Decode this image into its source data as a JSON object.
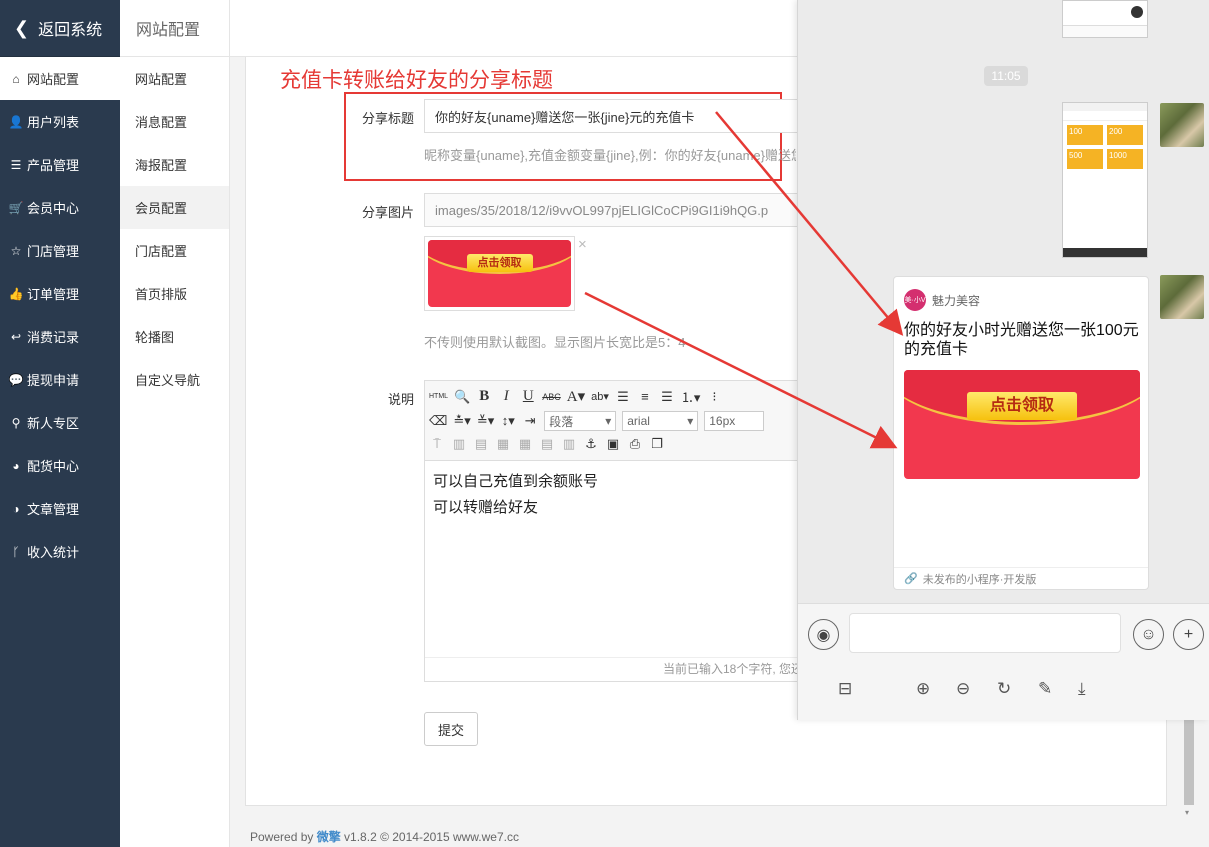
{
  "sidebar": {
    "back_label": "返回系统",
    "items": [
      {
        "label": "网站配置",
        "icon": "home-icon",
        "glyph": "⌂",
        "active": true
      },
      {
        "label": "用户列表",
        "icon": "user-icon",
        "glyph": "👤",
        "active": false
      },
      {
        "label": "产品管理",
        "icon": "server-icon",
        "glyph": "☰",
        "active": false
      },
      {
        "label": "会员中心",
        "icon": "cart-icon",
        "glyph": "🛒",
        "active": false
      },
      {
        "label": "门店管理",
        "icon": "star-icon",
        "glyph": "☆",
        "active": false
      },
      {
        "label": "订单管理",
        "icon": "thumbs-up-icon",
        "glyph": "👍",
        "active": false
      },
      {
        "label": "消费记录",
        "icon": "reply-icon",
        "glyph": "↩",
        "active": false
      },
      {
        "label": "提现申请",
        "icon": "wechat-icon",
        "glyph": "💬",
        "active": false
      },
      {
        "label": "新人专区",
        "icon": "map-pin-icon",
        "glyph": "⚲",
        "active": false
      },
      {
        "label": "配货中心",
        "icon": "pie-chart-icon",
        "glyph": "◕",
        "active": false
      },
      {
        "label": "文章管理",
        "icon": "adjust-icon",
        "glyph": "◑",
        "active": false
      },
      {
        "label": "收入统计",
        "icon": "branch-icon",
        "glyph": "ᚴ",
        "active": false
      }
    ]
  },
  "subnav": {
    "header": "网站配置",
    "items": [
      {
        "label": "网站配置",
        "active": false
      },
      {
        "label": "消息配置",
        "active": false
      },
      {
        "label": "海报配置",
        "active": false
      },
      {
        "label": "会员配置",
        "active": true
      },
      {
        "label": "门店配置",
        "active": false
      },
      {
        "label": "首页排版",
        "active": false
      },
      {
        "label": "轮播图",
        "active": false
      },
      {
        "label": "自定义导航",
        "active": false
      }
    ]
  },
  "annotation": {
    "title": "充值卡转账给好友的分享标题"
  },
  "form": {
    "share_title": {
      "label": "分享标题",
      "value": "你的好友{uname}赠送您一张{jine}元的充值卡",
      "help": "昵称变量{uname},充值金额变量{jine},例：你的好友{uname}赠送您"
    },
    "share_image": {
      "label": "分享图片",
      "value": "images/35/2018/12/i9vvOL997pjELIGlCoCPi9GI1i9hQG.p",
      "button_text": "点击领取",
      "remove": "×",
      "help": "不传则使用默认截图。显示图片长宽比是5：4"
    },
    "description": {
      "label": "说明",
      "toolbar": {
        "paragraph": "段落",
        "font": "arial",
        "size": "16px",
        "html_label": "HTML"
      },
      "lines": [
        "可以自己充值到余额账号",
        "可以转赠给好友"
      ],
      "count_text": "当前已输入18个字符, 您还"
    },
    "submit_label": "提交"
  },
  "footer": {
    "prefix": "Powered by ",
    "brand": "微擎",
    "suffix": " v1.8.2 © 2014-2015 www.we7.cc"
  },
  "chat": {
    "time": "11:05",
    "card": {
      "app_name": "魅力美容",
      "logo_text": "美·小V",
      "title": "你的好友小时光赠送您一张100元的充值卡",
      "button_text": "点击领取",
      "footer": "未发布的小程序·开发版"
    },
    "phone": {
      "amounts": [
        "100",
        "200",
        "500",
        "1000"
      ]
    }
  },
  "colors": {
    "sidebar_bg": "#2a3a4e",
    "annotation_red": "#e53935",
    "envelope_red": "#f2384e",
    "gold": "#f6c10e"
  }
}
